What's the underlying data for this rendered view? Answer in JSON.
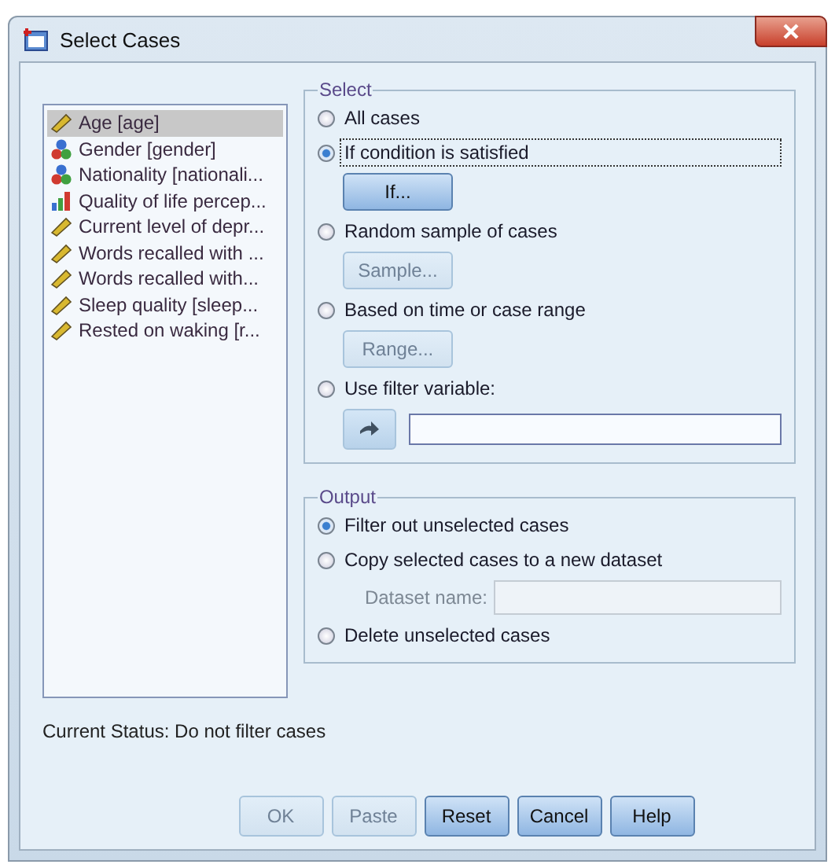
{
  "window": {
    "title": "Select Cases"
  },
  "variables": [
    {
      "label": "Age [age]",
      "kind": "scale",
      "selected": true
    },
    {
      "label": "Gender [gender]",
      "kind": "nominal",
      "selected": false
    },
    {
      "label": "Nationality [nationali...",
      "kind": "nominal",
      "selected": false
    },
    {
      "label": "Quality of life percep...",
      "kind": "ordinal",
      "selected": false
    },
    {
      "label": "Current level of depr...",
      "kind": "scale",
      "selected": false
    },
    {
      "label": "Words recalled with ...",
      "kind": "scale",
      "selected": false
    },
    {
      "label": "Words recalled with...",
      "kind": "scale",
      "selected": false
    },
    {
      "label": "Sleep quality [sleep...",
      "kind": "scale",
      "selected": false
    },
    {
      "label": "Rested on waking [r...",
      "kind": "scale",
      "selected": false
    }
  ],
  "select": {
    "title": "Select",
    "options": [
      {
        "label": "All cases",
        "selected": false,
        "focused": false
      },
      {
        "label": "If condition is satisfied",
        "selected": true,
        "focused": true,
        "button": {
          "label": "If...",
          "disabled": false
        }
      },
      {
        "label": "Random sample of cases",
        "selected": false,
        "focused": false,
        "button": {
          "label": "Sample...",
          "disabled": true
        }
      },
      {
        "label": "Based on time or case range",
        "selected": false,
        "focused": false,
        "button": {
          "label": "Range...",
          "disabled": true
        }
      },
      {
        "label": "Use filter variable:",
        "selected": false,
        "focused": false,
        "filter": true
      }
    ]
  },
  "output": {
    "title": "Output",
    "options": [
      {
        "label": "Filter out unselected cases",
        "selected": true
      },
      {
        "label": "Copy selected cases to a new dataset",
        "selected": false,
        "dataset_label": "Dataset name:",
        "dataset_disabled": true
      },
      {
        "label": "Delete unselected cases",
        "selected": false
      }
    ]
  },
  "status": "Current Status: Do not filter cases",
  "buttons": [
    {
      "label": "OK",
      "disabled": true
    },
    {
      "label": "Paste",
      "disabled": true
    },
    {
      "label": "Reset",
      "disabled": false
    },
    {
      "label": "Cancel",
      "disabled": false
    },
    {
      "label": "Help",
      "disabled": false
    }
  ]
}
